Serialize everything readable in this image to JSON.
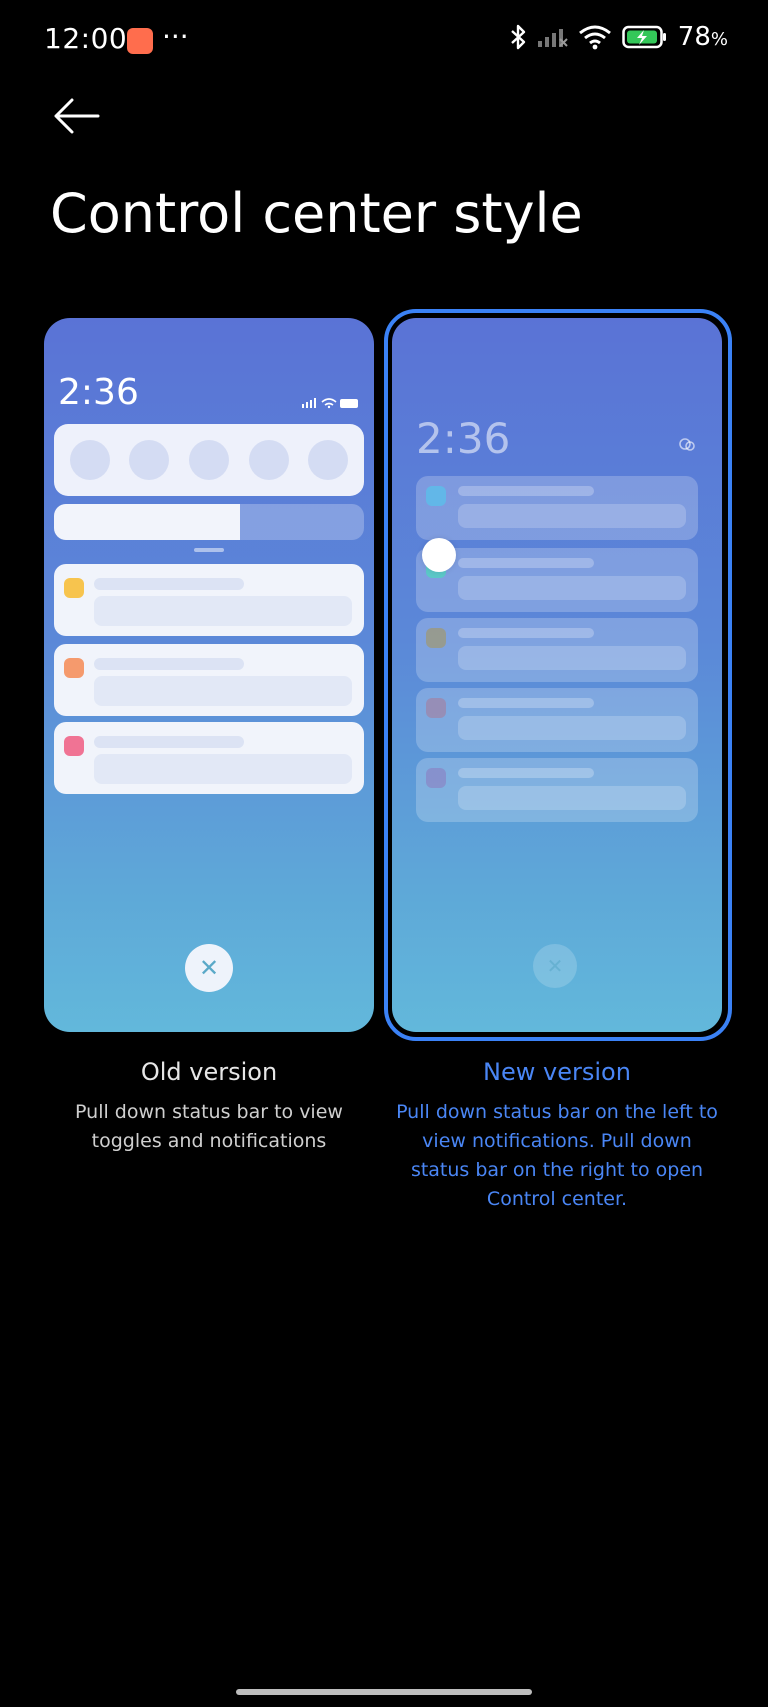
{
  "status_bar": {
    "time": "12:00",
    "overflow": "···",
    "battery_percent": "78",
    "battery_unit": "%",
    "icons": [
      "bluetooth-icon",
      "signal-icon",
      "wifi-icon",
      "battery-icon"
    ]
  },
  "header": {
    "title": "Control center style"
  },
  "options": [
    {
      "key": "old",
      "title": "Old version",
      "description": "Pull down status bar to view toggles and notifications",
      "preview_time": "2:36",
      "selected": false
    },
    {
      "key": "new",
      "title": "New version",
      "description": "Pull down status bar on the left to view notifications. Pull down status bar on the right to open Control center.",
      "preview_time": "2:36",
      "selected": true
    }
  ],
  "colors": {
    "accent": "#3b82f6",
    "accent_text": "#4a86f5",
    "notif_yellow": "#f7c44e",
    "notif_orange": "#f59a6d",
    "notif_pink": "#f07394",
    "notif_blue": "#62b7e8",
    "notif_teal": "#5bc7c7"
  }
}
